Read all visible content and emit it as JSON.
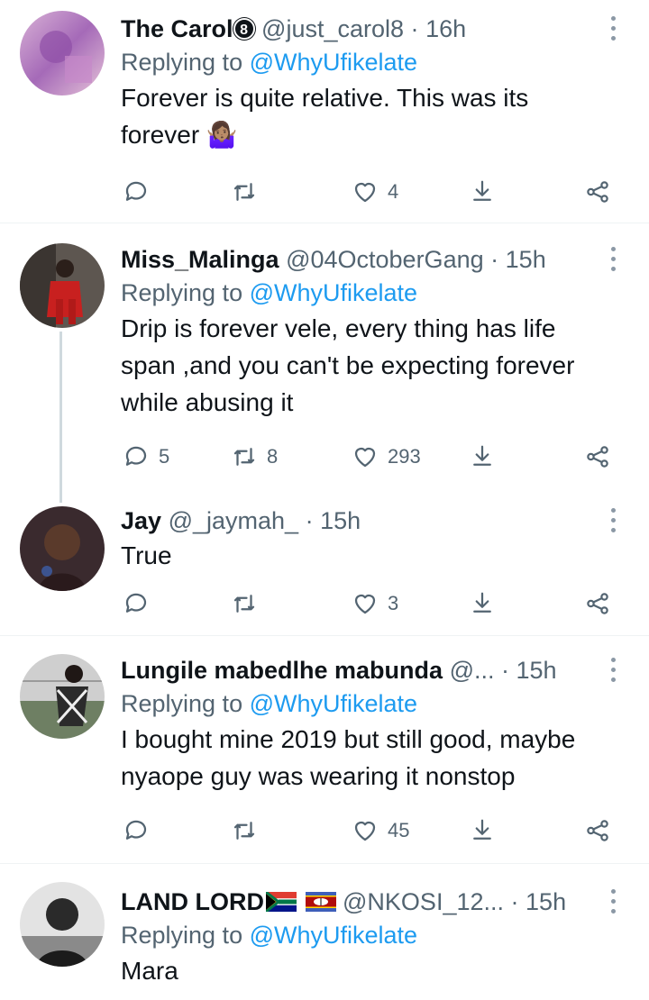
{
  "replying_prefix": "Replying to",
  "tweets": [
    {
      "name": "The Carol",
      "badge": "8",
      "handle": "@just_carol8",
      "separator": "·",
      "time": "16h",
      "replying_to": "@WhyUfikelate",
      "text_lines": [
        "Forever is quite relative. This was its",
        "forever 🤷🏽‍♀️"
      ],
      "replies": "",
      "retweets": "",
      "likes": "4"
    },
    {
      "name": "Miss_Malinga",
      "handle": "@04OctoberGang",
      "separator": "·",
      "time": "15h",
      "replying_to": "@WhyUfikelate",
      "text_lines": [
        "Drip is forever vele, every thing has life",
        "span ,and you can't be expecting forever",
        "while abusing it"
      ],
      "replies": "5",
      "retweets": "8",
      "likes": "293"
    },
    {
      "name": "Jay",
      "handle": "@_jaymah_",
      "separator": "·",
      "time": "15h",
      "text_lines": [
        "True"
      ],
      "replies": "",
      "retweets": "",
      "likes": "3"
    },
    {
      "name": "Lungile mabedlhe mabunda",
      "handle": "@...",
      "separator": "·",
      "time": "15h",
      "replying_to": "@WhyUfikelate",
      "text_lines": [
        "I bought mine 2019 but still good, maybe",
        "nyaope guy was wearing it nonstop"
      ],
      "replies": "",
      "retweets": "",
      "likes": "45"
    },
    {
      "name": "LAND LORD",
      "handle": "@NKOSI_12...",
      "separator": "·",
      "time": "15h",
      "replying_to": "@WhyUfikelate",
      "text_lines": [
        "Mara"
      ]
    }
  ],
  "icons": {
    "reply": "reply-icon",
    "retweet": "retweet-icon",
    "like": "heart-icon",
    "bookmark": "download-icon",
    "share": "share-icon",
    "more": "more-icon"
  },
  "colors": {
    "link": "#1d9bf0",
    "secondary": "#536471",
    "divider": "#eff3f4"
  }
}
